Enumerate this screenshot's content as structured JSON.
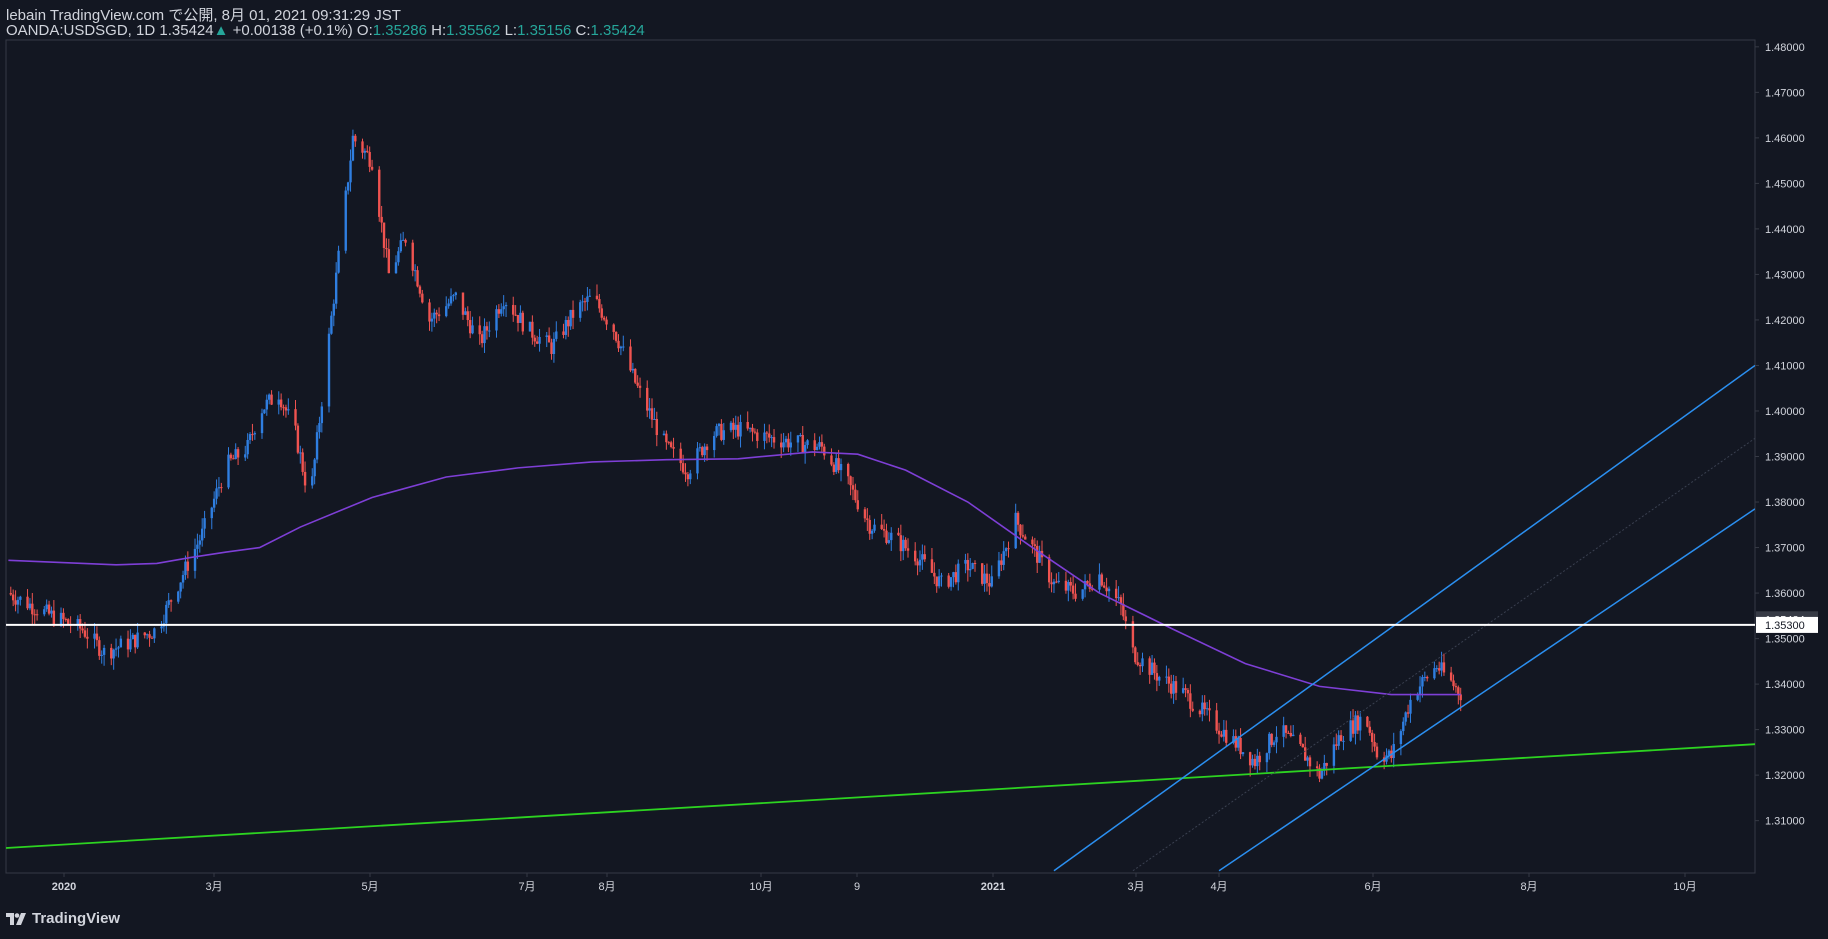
{
  "header": {
    "publish_line": "lebain TradingView.com で公開, 8月 01, 2021 09:31:29 JST",
    "symbol": "OANDA:USDSGD, 1D",
    "last": "1.35424",
    "change_arrow": "▲",
    "change": "+0.00138 (+0.1%)",
    "o_label": "O:",
    "o_value": "1.35286",
    "h_label": "H:",
    "h_value": "1.35562",
    "l_label": "L:",
    "l_value": "1.35156",
    "c_label": "C:",
    "c_value": "1.35424"
  },
  "footer": {
    "logo_text": "TradingView",
    "logo_icon": "tradingview-logo-icon"
  },
  "colors": {
    "background": "#131722",
    "up": "#2f7ee0",
    "down": "#ef5350",
    "ma": "#7e3fd6",
    "support": "#2dd321",
    "channel": "#2b8ff0",
    "hline": "#ffffff",
    "axis_text": "#d1d4dc",
    "grid_border": "#363a45"
  },
  "chart_data": {
    "type": "candlestick",
    "symbol": "OANDA:USDSGD",
    "interval": "1D",
    "y_axis": {
      "ticks": [
        "1.48000",
        "1.47000",
        "1.46000",
        "1.45000",
        "1.44000",
        "1.43000",
        "1.42000",
        "1.41000",
        "1.40000",
        "1.39000",
        "1.38000",
        "1.37000",
        "1.36000",
        "1.35000",
        "1.34000",
        "1.33000",
        "1.32000",
        "1.31000"
      ],
      "range": [
        1.2985,
        1.4815
      ]
    },
    "x_axis": {
      "labels": [
        "2020",
        "3月",
        "5月",
        "7月",
        "8月",
        "10月",
        "9",
        "2021",
        "3月",
        "4月",
        "6月",
        "8月",
        "10月"
      ],
      "range": [
        "2019-11-30",
        "2021-11-30"
      ]
    },
    "price_badges": [
      {
        "value": "1.35424",
        "style": "last"
      },
      {
        "value": "1.35300",
        "style": "line"
      }
    ],
    "horizontal_line": 1.353,
    "ma_line": [
      [
        "2019-12-01",
        1.3672
      ],
      [
        "2020-01-15",
        1.3662
      ],
      [
        "2020-02-01",
        1.3665
      ],
      [
        "2020-02-15",
        1.3678
      ],
      [
        "2020-03-01",
        1.369
      ],
      [
        "2020-03-15",
        1.37
      ],
      [
        "2020-04-01",
        1.3745
      ],
      [
        "2020-05-01",
        1.381
      ],
      [
        "2020-06-01",
        1.3855
      ],
      [
        "2020-07-01",
        1.3875
      ],
      [
        "2020-08-01",
        1.3888
      ],
      [
        "2020-09-01",
        1.3893
      ],
      [
        "2020-10-01",
        1.3895
      ],
      [
        "2020-11-01",
        1.391
      ],
      [
        "2020-11-20",
        1.3905
      ],
      [
        "2020-12-10",
        1.387
      ],
      [
        "2021-01-05",
        1.38
      ],
      [
        "2021-02-01",
        1.37
      ],
      [
        "2021-03-01",
        1.36
      ],
      [
        "2021-04-01",
        1.352
      ],
      [
        "2021-05-01",
        1.3445
      ],
      [
        "2021-06-01",
        1.3395
      ],
      [
        "2021-07-01",
        1.3377
      ],
      [
        "2021-07-30",
        1.3377
      ]
    ],
    "support_line": [
      [
        "2019-11-30",
        1.304
      ],
      [
        "2021-11-30",
        1.3268
      ]
    ],
    "channel_upper": [
      [
        "2021-02-10",
        1.299
      ],
      [
        "2021-11-30",
        1.41
      ]
    ],
    "channel_lower": [
      [
        "2021-04-20",
        1.299
      ],
      [
        "2021-11-30",
        1.3785
      ]
    ],
    "channel_mid": [
      [
        "2021-03-15",
        1.299
      ],
      [
        "2021-11-30",
        1.394
      ]
    ],
    "close_series": [
      [
        "2019-12-01",
        1.36
      ],
      [
        "2019-12-15",
        1.356
      ],
      [
        "2020-01-01",
        1.352
      ],
      [
        "2020-01-10",
        1.347
      ],
      [
        "2020-01-20",
        1.349
      ],
      [
        "2020-02-01",
        1.352
      ],
      [
        "2020-02-10",
        1.362
      ],
      [
        "2020-02-20",
        1.373
      ],
      [
        "2020-03-01",
        1.388
      ],
      [
        "2020-03-10",
        1.392
      ],
      [
        "2020-03-15",
        1.4
      ],
      [
        "2020-03-23",
        1.404
      ],
      [
        "2020-03-30",
        1.395
      ],
      [
        "2020-04-05",
        1.38
      ],
      [
        "2020-04-15",
        1.425
      ],
      [
        "2020-04-23",
        1.46
      ],
      [
        "2020-05-01",
        1.455
      ],
      [
        "2020-05-08",
        1.43
      ],
      [
        "2020-05-15",
        1.438
      ],
      [
        "2020-05-25",
        1.42
      ],
      [
        "2020-06-05",
        1.425
      ],
      [
        "2020-06-15",
        1.415
      ],
      [
        "2020-06-25",
        1.425
      ],
      [
        "2020-07-05",
        1.418
      ],
      [
        "2020-07-15",
        1.414
      ],
      [
        "2020-07-25",
        1.422
      ],
      [
        "2020-08-01",
        1.425
      ],
      [
        "2020-08-10",
        1.418
      ],
      [
        "2020-08-20",
        1.405
      ],
      [
        "2020-09-01",
        1.392
      ],
      [
        "2020-09-10",
        1.387
      ],
      [
        "2020-09-20",
        1.395
      ],
      [
        "2020-10-01",
        1.396
      ],
      [
        "2020-10-15",
        1.394
      ],
      [
        "2020-10-25",
        1.393
      ],
      [
        "2020-11-05",
        1.392
      ],
      [
        "2020-11-15",
        1.385
      ],
      [
        "2020-11-25",
        1.375
      ],
      [
        "2020-12-05",
        1.372
      ],
      [
        "2020-12-15",
        1.368
      ],
      [
        "2020-12-25",
        1.362
      ],
      [
        "2021-01-05",
        1.366
      ],
      [
        "2021-01-15",
        1.362
      ],
      [
        "2021-01-25",
        1.376
      ],
      [
        "2021-02-01",
        1.37
      ],
      [
        "2021-02-10",
        1.362
      ],
      [
        "2021-02-20",
        1.36
      ],
      [
        "2021-03-01",
        1.364
      ],
      [
        "2021-03-10",
        1.357
      ],
      [
        "2021-03-15",
        1.347
      ],
      [
        "2021-03-25",
        1.342
      ],
      [
        "2021-04-05",
        1.338
      ],
      [
        "2021-04-15",
        1.333
      ],
      [
        "2021-04-25",
        1.328
      ],
      [
        "2021-05-05",
        1.323
      ],
      [
        "2021-05-15",
        1.33
      ],
      [
        "2021-05-25",
        1.325
      ],
      [
        "2021-06-01",
        1.32
      ],
      [
        "2021-06-10",
        1.329
      ],
      [
        "2021-06-20",
        1.333
      ],
      [
        "2021-06-25",
        1.325
      ],
      [
        "2021-07-01",
        1.324
      ],
      [
        "2021-07-10",
        1.338
      ],
      [
        "2021-07-20",
        1.344
      ],
      [
        "2021-07-30",
        1.338
      ]
    ]
  }
}
